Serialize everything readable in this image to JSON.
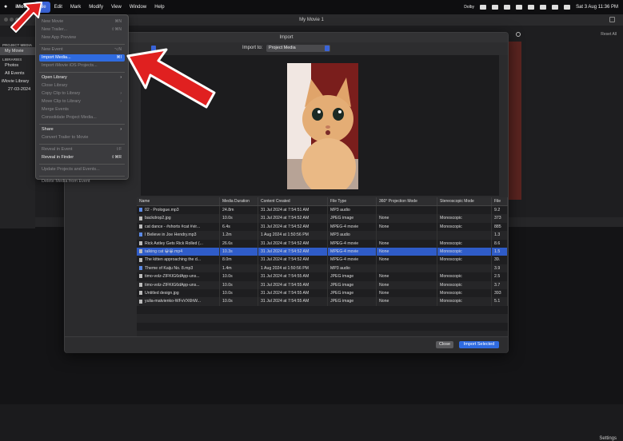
{
  "menubar": {
    "app": "iMovie",
    "items": [
      "File",
      "Edit",
      "Mark",
      "Modify",
      "View",
      "Window",
      "Help"
    ],
    "active": "File",
    "date_time": "Sat 3 Aug  11:36 PM",
    "tray_label": "Dolby"
  },
  "window": {
    "title": "My Movie 1",
    "reset_all": "Reset All",
    "settings": "Settings"
  },
  "sidebar": {
    "project_media": "PROJECT MEDIA",
    "project_item": "My Movie",
    "libraries": "LIBRARIES",
    "photos": "Photos",
    "all_events": "All Events",
    "library": "iMovie Library",
    "event": "27-03-2024"
  },
  "file_menu": {
    "items": [
      {
        "label": "New Movie",
        "shortcut": "⌘N",
        "enabled": false
      },
      {
        "label": "New Trailer...",
        "shortcut": "⇧⌘N",
        "enabled": false
      },
      {
        "label": "New App Preview",
        "shortcut": "",
        "enabled": false
      },
      {
        "sep": true
      },
      {
        "label": "New Event",
        "shortcut": "⌥N",
        "enabled": false
      },
      {
        "label": "Import Media...",
        "shortcut": "⌘I",
        "enabled": true,
        "highlighted": true
      },
      {
        "label": "Import iMovie iOS Projects...",
        "shortcut": "",
        "enabled": false
      },
      {
        "sep": true
      },
      {
        "label": "Open Library",
        "shortcut": "›",
        "enabled": true
      },
      {
        "label": "Close Library",
        "shortcut": "",
        "enabled": false
      },
      {
        "label": "Copy Clip to Library",
        "shortcut": "›",
        "enabled": false
      },
      {
        "label": "Move Clip to Library",
        "shortcut": "›",
        "enabled": false
      },
      {
        "label": "Merge Events",
        "shortcut": "",
        "enabled": false
      },
      {
        "label": "Consolidate Project Media...",
        "shortcut": "",
        "enabled": false
      },
      {
        "sep": true
      },
      {
        "label": "Share",
        "shortcut": "›",
        "enabled": true
      },
      {
        "label": "Convert Trailer to Movie",
        "shortcut": "",
        "enabled": false
      },
      {
        "sep": true
      },
      {
        "label": "Reveal in Event",
        "shortcut": "⇧F",
        "enabled": false
      },
      {
        "label": "Reveal in Finder",
        "shortcut": "⇧⌘R",
        "enabled": true
      },
      {
        "sep": true
      },
      {
        "label": "Update Projects and Events...",
        "shortcut": "",
        "enabled": false
      },
      {
        "sep": true
      },
      {
        "label": "Delete Media from Event",
        "shortcut": "",
        "enabled": false
      }
    ]
  },
  "dialog": {
    "title": "Import",
    "import_to_label": "Import to:",
    "import_to_value": "Project Media",
    "close_label": "Close",
    "import_label": "Import Selected",
    "columns": [
      "Name",
      "Media Duration",
      "Content Created",
      "File Type",
      "360° Projection Mode",
      "Stereoscopic Mode",
      "File"
    ],
    "rows": [
      {
        "name": "02 - Prologue.mp3",
        "dur": "24.8m",
        "created": "31 Jul 2024 at 7:54:51 AM",
        "type": "MP3 audio",
        "proj": "",
        "stereo": "",
        "size": "9.2",
        "icon": "blue"
      },
      {
        "name": "backdrop2.jpg",
        "dur": "10.0s",
        "created": "31 Jul 2024 at 7:54:52 AM",
        "type": "JPEG image",
        "proj": "None",
        "stereo": "Monoscopic",
        "size": "373",
        "icon": "grey"
      },
      {
        "name": "cat dance - #shorts #cat #vir...",
        "dur": "6.4s",
        "created": "31 Jul 2024 at 7:54:52 AM",
        "type": "MPEG-4 movie",
        "proj": "None",
        "stereo": "Monoscopic",
        "size": "885",
        "icon": "grey"
      },
      {
        "name": "I Believe in Joe Hendry.mp3",
        "dur": "1.2m",
        "created": "1 Aug 2024 at 1:50:56 PM",
        "type": "MP3 audio",
        "proj": "",
        "stereo": "",
        "size": "1.3",
        "icon": "blue"
      },
      {
        "name": "Rick Astley Gets Rick Rolled (...",
        "dur": "26.6s",
        "created": "31 Jul 2024 at 7:54:52 AM",
        "type": "MPEG-4 movie",
        "proj": "None",
        "stereo": "Monoscopic",
        "size": "8.6",
        "icon": "grey"
      },
      {
        "name": "talking cat 😀😀.mp4",
        "dur": "10.3s",
        "created": "31 Jul 2024 at 7:54:52 AM",
        "type": "MPEG-4 movie",
        "proj": "None",
        "stereo": "Monoscopic",
        "size": "1.5",
        "icon": "grey",
        "selected": true
      },
      {
        "name": "The kitten approaching the d...",
        "dur": "8.0m",
        "created": "31 Jul 2024 at 7:54:52 AM",
        "type": "MPEG-4 movie",
        "proj": "None",
        "stereo": "Monoscopic",
        "size": "39.",
        "icon": "grey"
      },
      {
        "name": "Theme of Kaiju No. 8.mp3",
        "dur": "1.4m",
        "created": "1 Aug 2024 at 1:50:56 PM",
        "type": "MP3 audio",
        "proj": "",
        "stereo": "",
        "size": "3.9",
        "icon": "blue"
      },
      {
        "name": "timo-volz-ZIFKIG6dApp-uns...",
        "dur": "10.0s",
        "created": "31 Jul 2024 at 7:54:55 AM",
        "type": "JPEG image",
        "proj": "None",
        "stereo": "Monoscopic",
        "size": "2.5",
        "icon": "grey"
      },
      {
        "name": "timo-volz-ZIFKIG6dApp-uns...",
        "dur": "10.0s",
        "created": "31 Jul 2024 at 7:54:55 AM",
        "type": "JPEG image",
        "proj": "None",
        "stereo": "Monoscopic",
        "size": "3.7",
        "icon": "grey"
      },
      {
        "name": "Untitled design.jpg",
        "dur": "10.0s",
        "created": "31 Jul 2024 at 7:54:55 AM",
        "type": "JPEG image",
        "proj": "None",
        "stereo": "Monoscopic",
        "size": "393",
        "icon": "grey"
      },
      {
        "name": "yulia-matvienko-WFvVX6hW...",
        "dur": "10.0s",
        "created": "31 Jul 2024 at 7:54:55 AM",
        "type": "JPEG image",
        "proj": "None",
        "stereo": "Monoscopic",
        "size": "5.1",
        "icon": "grey"
      }
    ]
  },
  "colors": {
    "accent": "#2f6be0",
    "annotation_arrow": "#e02020"
  }
}
